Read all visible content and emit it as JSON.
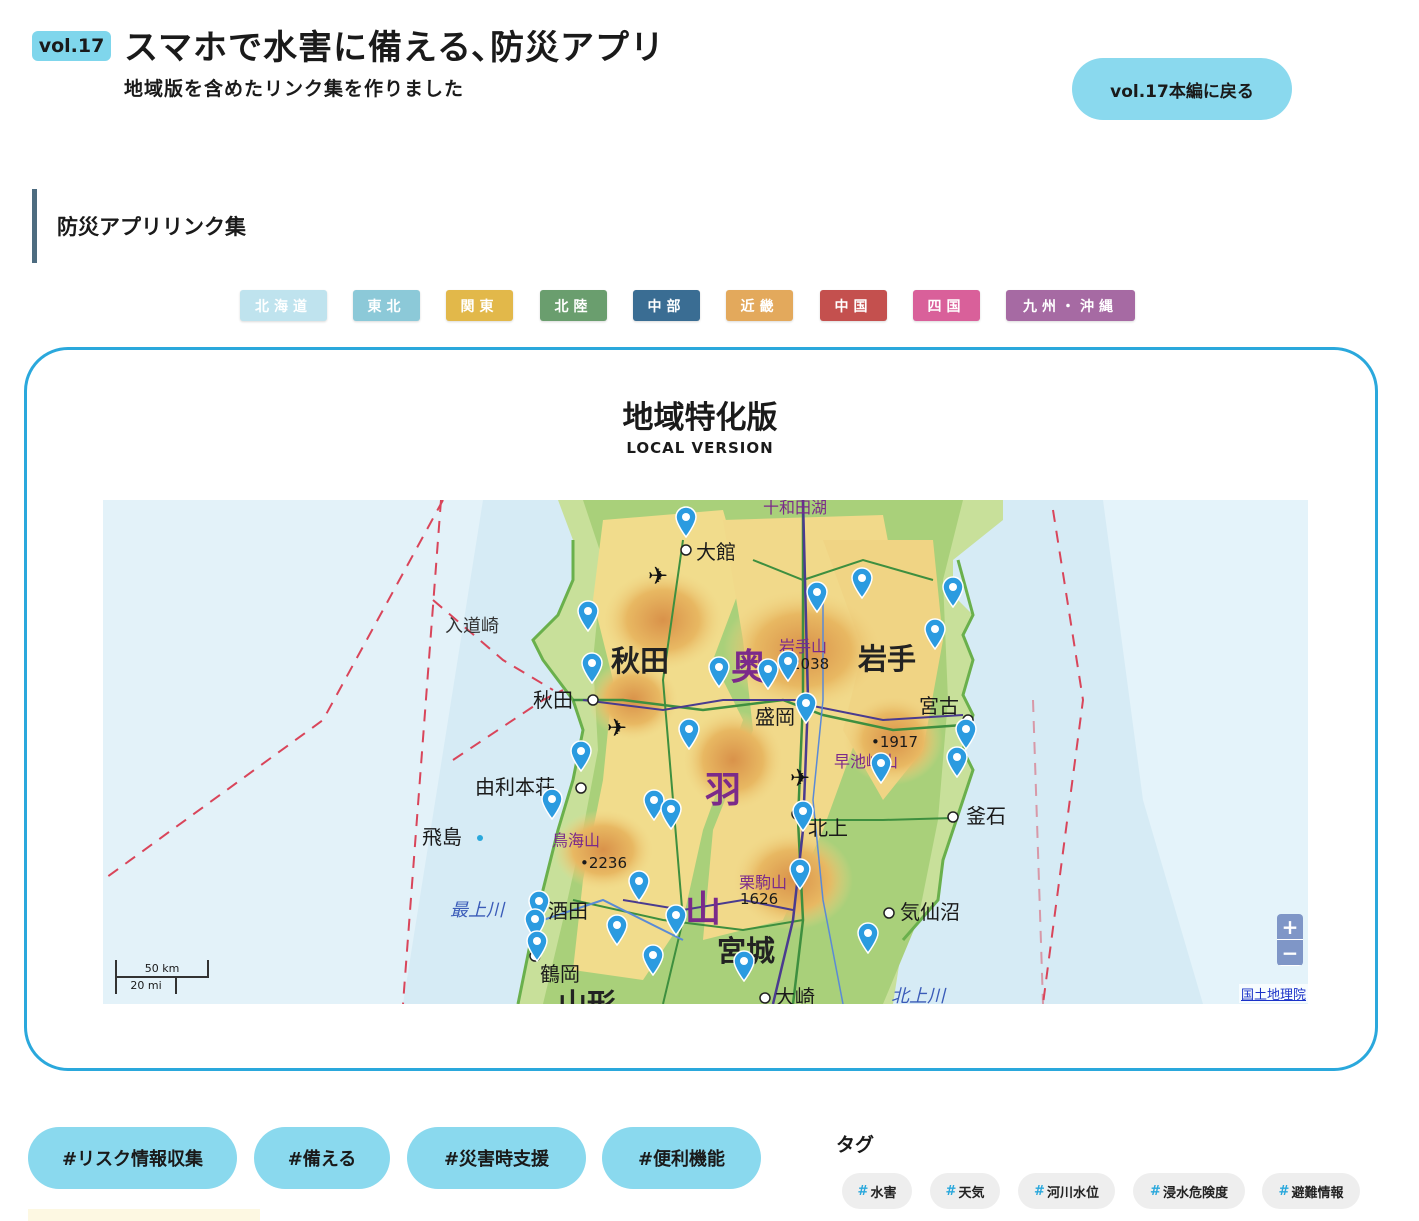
{
  "header": {
    "vol_badge": "vol.17",
    "title": "スマホで水害に備える､防災アプリ",
    "subtitle": "地域版を含めたリンク集を作りました",
    "back_button": "vol.17本編に戻る"
  },
  "section": {
    "heading": "防災アプリリンク集"
  },
  "regions": [
    {
      "label": "北海道",
      "color": "#bfe3ee"
    },
    {
      "label": "東北",
      "color": "#8cc9d8"
    },
    {
      "label": "関東",
      "color": "#e2b84a"
    },
    {
      "label": "北陸",
      "color": "#6a9e6e"
    },
    {
      "label": "中部",
      "color": "#3a6d93"
    },
    {
      "label": "近畿",
      "color": "#e3a95c"
    },
    {
      "label": "中国",
      "color": "#c4504e"
    },
    {
      "label": "四国",
      "color": "#d9609a"
    },
    {
      "label": "九州・沖縄",
      "color": "#a66aa3"
    }
  ],
  "local_card": {
    "title": "地域特化版",
    "subtitle": "LOCAL VERSION",
    "map": {
      "prefecture_labels": [
        "秋田",
        "岩手",
        "宮城",
        "山形"
      ],
      "city_labels": [
        "大館",
        "秋田",
        "盛岡",
        "宮古",
        "由利本荘",
        "釜石",
        "北上",
        "酒田",
        "気仙沼",
        "鶴岡",
        "大崎"
      ],
      "mountain_labels": [
        "岩手山",
        "早池峰山",
        "鳥海山",
        "栗駒山"
      ],
      "range_labels": [
        "奥",
        "羽",
        "山"
      ],
      "elevation_labels": [
        "2038",
        "•1917",
        "•2236",
        "1626"
      ],
      "other_labels": [
        "入道崎",
        "飛島",
        "十和田湖"
      ],
      "river_labels": [
        "最上川",
        "北上川"
      ],
      "zoom_in": "+",
      "zoom_out": "−",
      "attribution": "国土地理院",
      "scale_km": "50 km",
      "scale_mi": "20 mi",
      "pin_count": 30,
      "pin_color": "#2b9be0"
    }
  },
  "categories": [
    "#リスク情報収集",
    "#備える",
    "#災害時支援",
    "#便利機能"
  ],
  "tags": {
    "heading": "タグ",
    "items": [
      "水害",
      "天気",
      "河川水位",
      "浸水危険度",
      "避難情報"
    ]
  }
}
